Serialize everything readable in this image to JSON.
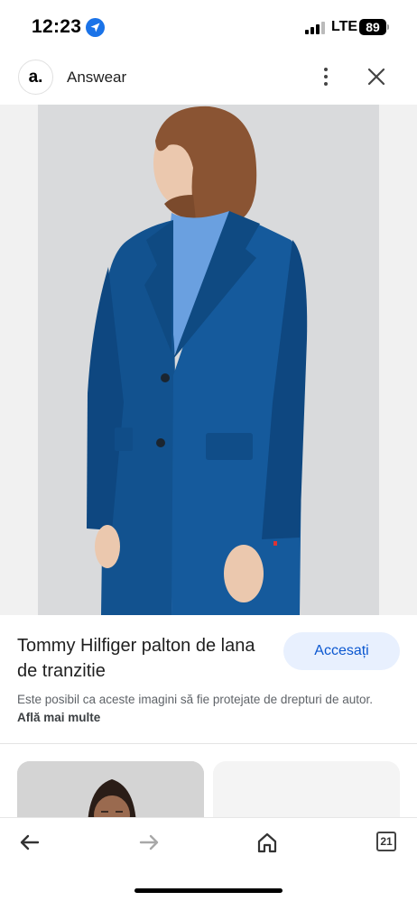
{
  "status_bar": {
    "time": "12:23",
    "network": "LTE",
    "battery": "89"
  },
  "header": {
    "logo_text": "a.",
    "site_name": "Answear"
  },
  "product": {
    "title": "Tommy Hilfiger palton de lana de tranzitie",
    "visit_label": "Accesați",
    "disclaimer": "Este posibil ca aceste imagini să fie protejate de drepturi de autor.",
    "learn_more": "Află mai multe"
  },
  "bottom_bar": {
    "tab_count": "21"
  },
  "icons": [
    "location-arrow-icon",
    "signal-icon",
    "battery-icon",
    "more-vert-icon",
    "close-icon",
    "back-arrow-icon",
    "forward-arrow-icon",
    "home-icon",
    "tabs-icon"
  ],
  "colors": {
    "accent": "#0b57d0",
    "button_bg": "#e8f0fe",
    "coat": "#12528f",
    "turtleneck": "#6aa0e0"
  }
}
